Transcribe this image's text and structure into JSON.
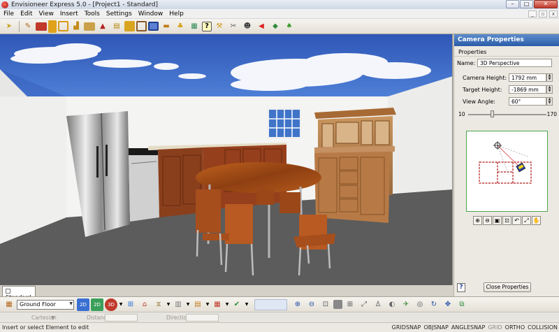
{
  "window": {
    "title": "Envisioneer Express 5.0 - [Project1 - Standard]",
    "minimize": "–",
    "maximize": "□",
    "close": "✕"
  },
  "menu": [
    "File",
    "Edit",
    "View",
    "Insert",
    "Tools",
    "Settings",
    "Window",
    "Help"
  ],
  "toolbar_icons": [
    "select-arrow-icon",
    "paint-brush-icon",
    "wall-tool-icon",
    "door-icon",
    "window-icon",
    "stairs-icon",
    "cabinet-icon",
    "roof-icon",
    "floor-icon",
    "material-icon",
    "frame-icon",
    "monitor-icon",
    "sofa-icon",
    "lamp-icon",
    "landscape-icon",
    "help-icon",
    "tools-icon",
    "dimension-icon",
    "person-icon",
    "arrow-icon",
    "terrain-icon",
    "plant-icon"
  ],
  "view_tab": "Standard",
  "camera_properties": {
    "title": "Camera Properties",
    "section": "Properties",
    "name_label": "Name:",
    "name_value": "3D Perspective",
    "camera_height_label": "Camera Height:",
    "camera_height_value": "1792 mm",
    "target_height_label": "Target Height:",
    "target_height_value": "-1869 mm",
    "view_angle_label": "View Angle:",
    "view_angle_value": "60°",
    "slider_min": "10",
    "slider_max": "170",
    "slider_level": 0.3125,
    "help": "?",
    "close_button": "Close Properties"
  },
  "bottom_toolbar": {
    "floor": "Ground Floor",
    "view_2d_icons": [
      "2D",
      "2D"
    ],
    "view_3d_label": "3D"
  },
  "coords": {
    "mode": "Cartesian",
    "distance": "Distance",
    "direction": "Direction"
  },
  "status": {
    "text": "Insert or select Element to edit",
    "snaps": [
      {
        "label": "GRIDSNAP",
        "active": true
      },
      {
        "label": "OBJSNAP",
        "active": true
      },
      {
        "label": "ANGLESNAP",
        "active": true
      },
      {
        "label": "GRID",
        "active": false
      },
      {
        "label": "ORTHO",
        "active": true
      },
      {
        "label": "COLLISION",
        "active": true
      }
    ]
  },
  "colors": {
    "titlebar": "#cfd8e6",
    "panel_header": "#2a5ca8",
    "sky": "#3a66c7",
    "floor": "#5c5c5c",
    "wall": "#f2f2f0",
    "wood": "#9a4e1e"
  }
}
